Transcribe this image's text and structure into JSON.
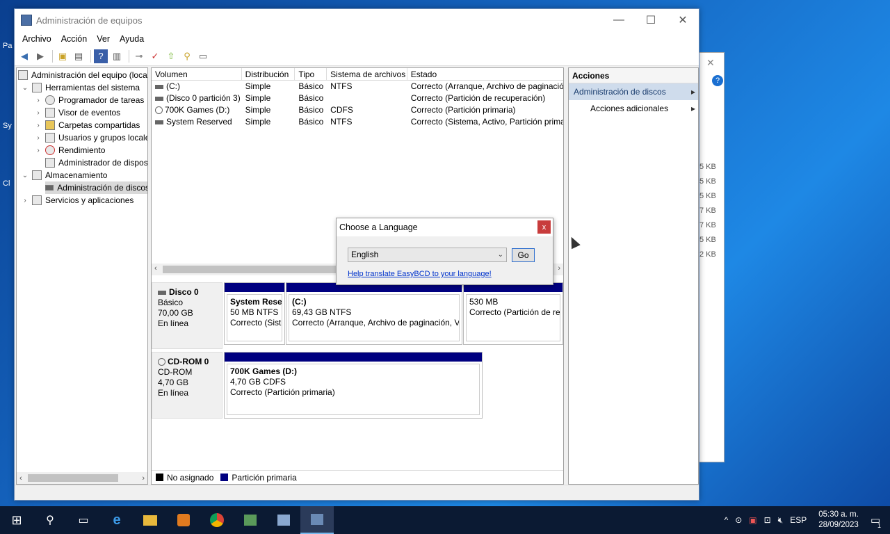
{
  "window": {
    "title": "Administración de equipos",
    "min": "—",
    "max": "☐",
    "close": "✕"
  },
  "menu": [
    "Archivo",
    "Acción",
    "Ver",
    "Ayuda"
  ],
  "tree": {
    "root": "Administración del equipo (local)",
    "tools": "Herramientas del sistema",
    "task_scheduler": "Programador de tareas",
    "event_viewer": "Visor de eventos",
    "shared_folders": "Carpetas compartidas",
    "users_groups": "Usuarios y grupos locales",
    "performance": "Rendimiento",
    "device_manager": "Administrador de dispositivos",
    "storage": "Almacenamiento",
    "disk_management": "Administración de discos",
    "services": "Servicios y aplicaciones"
  },
  "volumes": {
    "columns": [
      "Volumen",
      "Distribución",
      "Tipo",
      "Sistema de archivos",
      "Estado"
    ],
    "rows": [
      {
        "name": "(C:)",
        "layout": "Simple",
        "type": "Básico",
        "fs": "NTFS",
        "status": "Correcto (Arranque, Archivo de paginación"
      },
      {
        "name": "(Disco 0 partición 3)",
        "layout": "Simple",
        "type": "Básico",
        "fs": "",
        "status": "Correcto (Partición de recuperación)"
      },
      {
        "name": "700K Games (D:)",
        "layout": "Simple",
        "type": "Básico",
        "fs": "CDFS",
        "status": "Correcto (Partición primaria)"
      },
      {
        "name": "System Reserved",
        "layout": "Simple",
        "type": "Básico",
        "fs": "NTFS",
        "status": "Correcto (Sistema, Activo, Partición prima"
      }
    ]
  },
  "disks": {
    "disk0": {
      "name": "Disco 0",
      "type": "Básico",
      "size": "70,00 GB",
      "status": "En línea",
      "parts": [
        {
          "name": "System Reser",
          "size": "50 MB NTFS",
          "status": "Correcto (Siste"
        },
        {
          "name": "(C:)",
          "size": "69,43 GB NTFS",
          "status": "Correcto (Arranque, Archivo de paginación, V"
        },
        {
          "name": "",
          "size": "530 MB",
          "status": "Correcto (Partición de re"
        }
      ]
    },
    "cdrom0": {
      "name": "CD-ROM 0",
      "type": "CD-ROM",
      "size": "4,70 GB",
      "status": "En línea",
      "parts": [
        {
          "name": "700K Games  (D:)",
          "size": "4,70 GB CDFS",
          "status": "Correcto (Partición primaria)"
        }
      ]
    }
  },
  "legend": {
    "unallocated": "No asignado",
    "primary": "Partición primaria",
    "unallocated_color": "#000000",
    "primary_color": "#000080"
  },
  "actions": {
    "title": "Acciones",
    "item1": "Administración de discos",
    "item2": "Acciones adicionales",
    "arrow1": "▸",
    "arrow2": "▸"
  },
  "dialog": {
    "title": "Choose a Language",
    "close": "x",
    "selected_language": "English",
    "go": "Go",
    "link": "Help translate EasyBCD to your language!"
  },
  "bg_window_fragments": [
    "5 KB",
    "5 KB",
    "5 KB",
    "7 KB",
    "7 KB",
    "5 KB",
    "2 KB"
  ],
  "tray": {
    "lang": "ESP",
    "time": "05:30 a. m.",
    "date": "28/09/2023",
    "notification_count": "1"
  }
}
